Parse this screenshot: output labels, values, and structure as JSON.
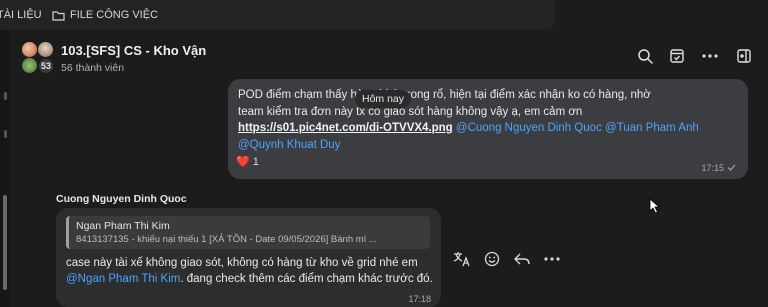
{
  "topbar": {
    "items": [
      {
        "icon": "folder-icon",
        "label": "TÀI LIỆU"
      },
      {
        "icon": "folder-icon",
        "label": "FILE CÔNG VIỆC"
      }
    ]
  },
  "header": {
    "title": "103.[SFS] CS - Kho Vận",
    "members": "56 thành viên",
    "avatar_count": "53",
    "icons": [
      "search-icon",
      "archive-icon",
      "more-icon",
      "toggle-panel-icon"
    ]
  },
  "date_separator": "Hôm nay",
  "own_message": {
    "line1": "POD điểm chạm thấy hàng bịch trong rổ, hiện tại điểm xác nhận ko có hàng, nhờ",
    "line2": "team kiểm tra đơn này tx có giao sót hàng không vậy ạ, em cảm ơn",
    "link": "https://s01.pic4net.com/di-OTVVX4.png",
    "mentions": [
      "@Cuong Nguyen Dinh Quoc",
      "@Tuan Pham Anh",
      "@Quynh Khuat Duy"
    ],
    "reaction_emoji": "❤️",
    "reaction_count": "1",
    "time": "17:15"
  },
  "other_message": {
    "sender": "Cuong Nguyen Dinh Quoc",
    "quote_name": "Ngan Pham Thi Kim",
    "quote_text": "8413137135 - khiếu nại thiếu 1 [XẢ TỒN - Date 09/05/2026] Bánh mì ...",
    "text_before": "case này tài xế không giao sót, không có hàng từ kho về grid nhé em",
    "mention": "@Ngan Pham Thi Kim",
    "text_after": ". đang check thêm các điểm chạm khác trước đó.",
    "time": "17:18"
  },
  "message_actions": [
    "translate-icon",
    "emoji-icon",
    "reply-icon",
    "more-icon"
  ],
  "colors": {
    "background": "#1c1c1d",
    "own_bubble": "#3b3d40",
    "other_bubble": "#2c2d2f",
    "mention": "#4ea3ff"
  }
}
